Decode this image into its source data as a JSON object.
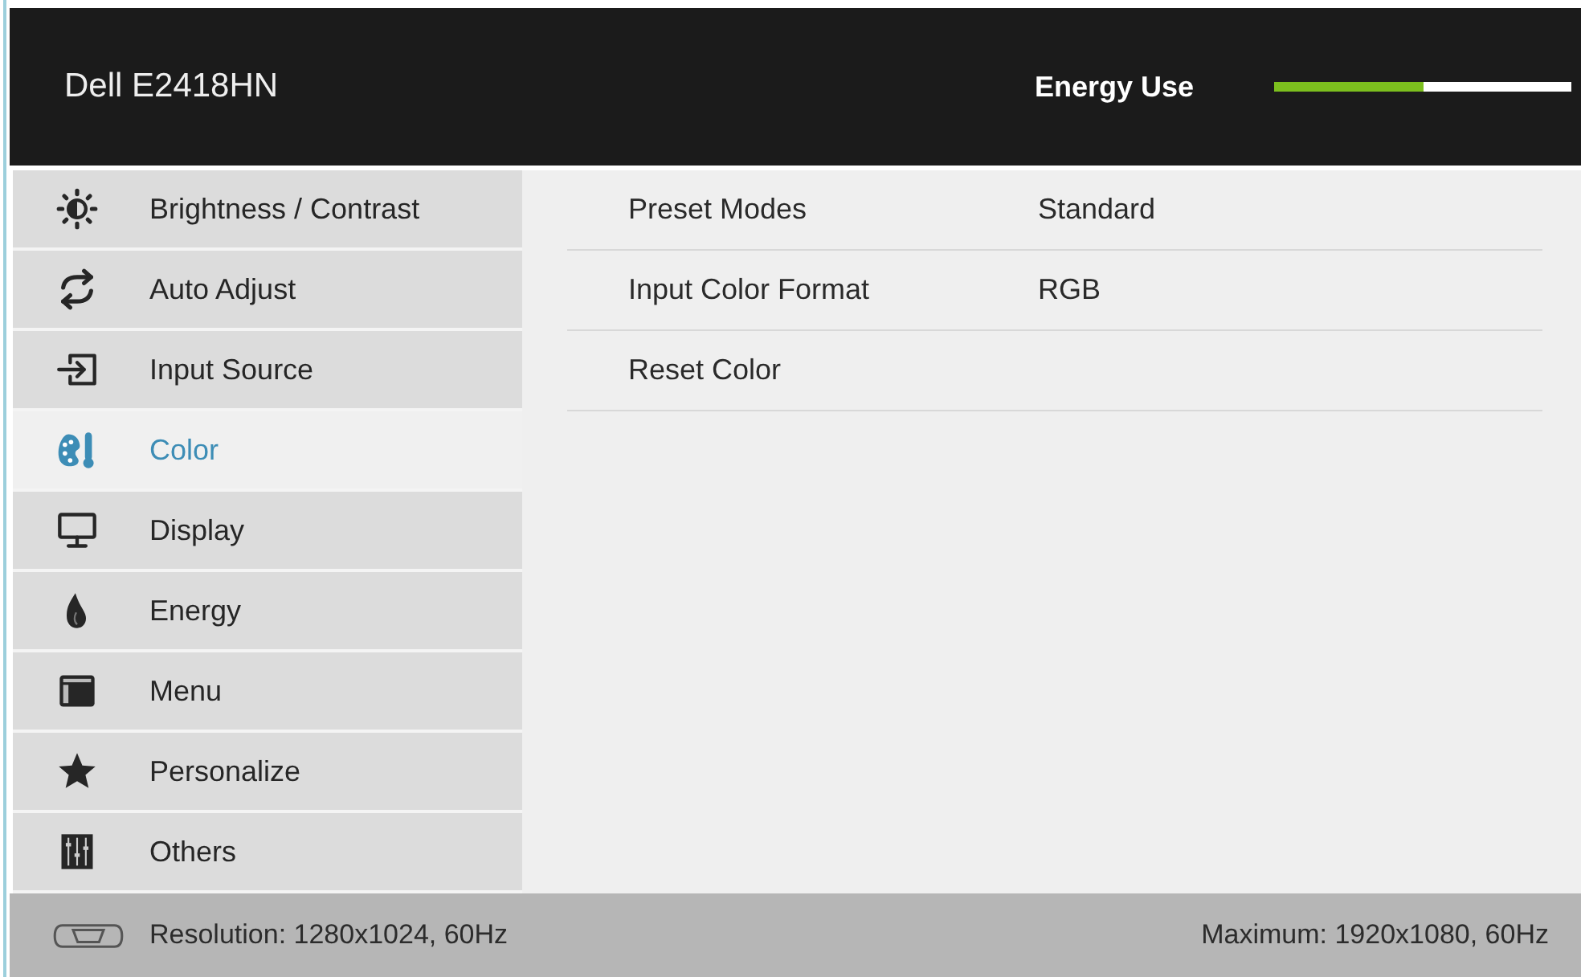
{
  "header": {
    "title": "Dell E2418HN",
    "energy_label": "Energy Use",
    "energy_meter": {
      "level": 0.5
    }
  },
  "sidebar": {
    "items": [
      {
        "label": "Brightness / Contrast",
        "selected": false
      },
      {
        "label": "Auto Adjust",
        "selected": false
      },
      {
        "label": "Input Source",
        "selected": false
      },
      {
        "label": "Color",
        "selected": true
      },
      {
        "label": "Display",
        "selected": false
      },
      {
        "label": "Energy",
        "selected": false
      },
      {
        "label": "Menu",
        "selected": false
      },
      {
        "label": "Personalize",
        "selected": false
      },
      {
        "label": "Others",
        "selected": false
      }
    ]
  },
  "settings": [
    {
      "label": "Preset Modes",
      "value": "Standard"
    },
    {
      "label": "Input Color Format",
      "value": "RGB"
    },
    {
      "label": "Reset Color"
    }
  ],
  "status_bar": {
    "resolution": "Resolution: 1280x1024, 60Hz",
    "maximum": "Maximum: 1920x1080, 60Hz"
  }
}
